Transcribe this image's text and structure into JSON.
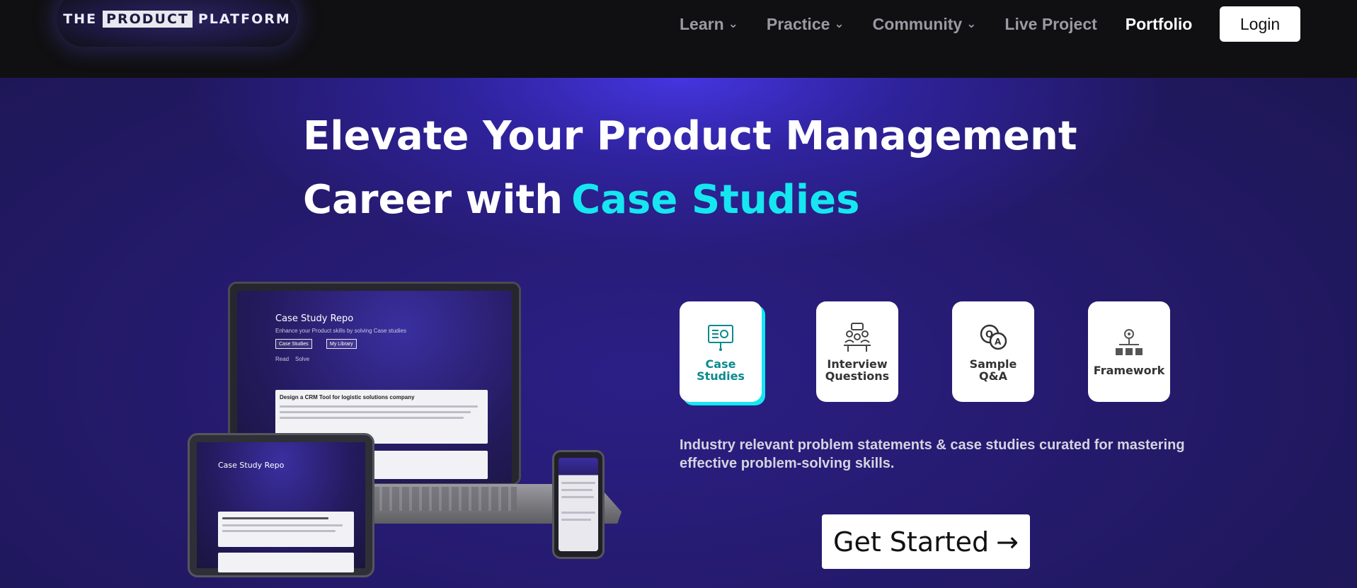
{
  "logo": {
    "prefix": "THE",
    "highlight": "PRODUCT",
    "suffix": "PLATFORM"
  },
  "nav": {
    "items": [
      {
        "label": "Learn",
        "dropdown": true
      },
      {
        "label": "Practice",
        "dropdown": true
      },
      {
        "label": "Community",
        "dropdown": true
      },
      {
        "label": "Live Project",
        "dropdown": false
      },
      {
        "label": "Portfolio",
        "dropdown": false
      }
    ],
    "login_label": "Login"
  },
  "hero": {
    "headline_line1": "Elevate Your Product Management",
    "headline_line2": "Career with",
    "headline_accent": "Case Studies",
    "description": "Industry relevant problem statements & case studies curated for mastering effective problem-solving skills.",
    "cta_label": "Get Started",
    "cta_icon": "arrow-right-icon"
  },
  "cards": [
    {
      "line1": "Case",
      "line2": "Studies",
      "icon": "presentation-board-icon",
      "active": true
    },
    {
      "line1": "Interview",
      "line2": "Questions",
      "icon": "interview-people-icon",
      "active": false
    },
    {
      "line1": "Sample",
      "line2": "Q&A",
      "icon": "qa-bubbles-icon",
      "active": false
    },
    {
      "line1": "Framework",
      "line2": "",
      "icon": "hierarchy-icon",
      "active": false
    }
  ],
  "mockup": {
    "repo_title": "Case Study Repo",
    "repo_subtitle": "Enhance your Product skills by solving Case studies",
    "tab_case_studies": "Case Studies",
    "tab_my_library": "My Library",
    "read": "Read",
    "solve": "Solve",
    "card_title": "Design a CRM Tool for logistic solutions company"
  },
  "colors": {
    "accent": "#16e6f0",
    "nav_bg": "#101012",
    "hero_bg": "#241a6b",
    "active_card_text": "#0a8a8f"
  }
}
